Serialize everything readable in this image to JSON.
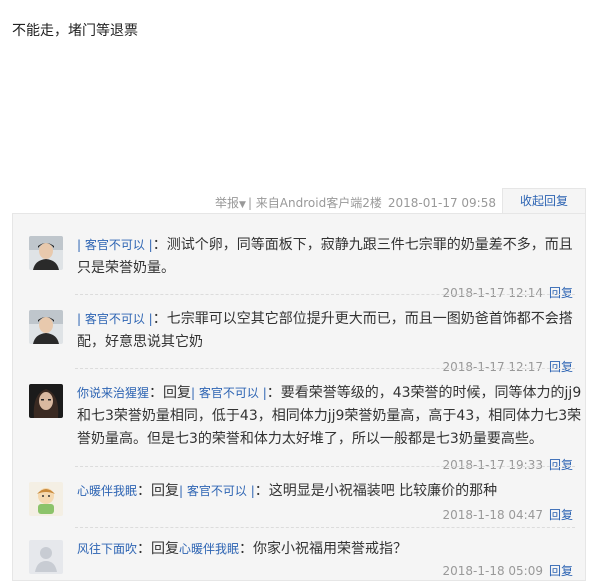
{
  "post": {
    "text": "不能走，堵门等退票"
  },
  "meta": {
    "report": "举报",
    "source": "| 来自Android客户端",
    "floor": "2楼",
    "time": "2018-01-17 09:58",
    "collapse": "收起回复"
  },
  "replies": [
    {
      "avatar": "avatar-boy",
      "user": "",
      "prefix": "",
      "mention": "| 客官不可以 |",
      "text": "：测试个卵，同等面板下，寂静九跟三件七宗罪的奶量差不多，而且只是荣誉奶量。",
      "time": "2018-1-17 12:14",
      "reply_label": "回复"
    },
    {
      "avatar": "avatar-boy",
      "user": "",
      "prefix": "",
      "mention": "| 客官不可以 |",
      "text": "：七宗罪可以空其它部位提升更大而已，而且一图奶爸首饰都不会搭配，好意思说其它奶",
      "time": "2018-1-17 12:17",
      "reply_label": "回复"
    },
    {
      "avatar": "avatar-girl",
      "user": "你说来治猩猩",
      "prefix": "：回复",
      "mention": "| 客官不可以 |",
      "text": "：要看荣誉等级的，43荣誉的时候，同等体力的jj9和七3荣誉奶量相同，低于43，相同体力jj9荣誉奶量高，高于43，相同体力七3荣誉奶量高。但是七3的荣誉和体力太好堆了，所以一般都是七3奶量要高些。",
      "time": "2018-1-17 19:33",
      "reply_label": "回复"
    },
    {
      "avatar": "avatar-cartoon",
      "user": "心暖伴我眠",
      "prefix": "：回复",
      "mention": "| 客官不可以 |",
      "text": "：这明显是小祝福装吧 比较廉价的那种",
      "time": "2018-1-18 04:47",
      "reply_label": "回复"
    },
    {
      "avatar": "avatar-default",
      "user": "风往下面吹",
      "prefix": "：回复",
      "mention": "心暖伴我眠",
      "text": "：你家小祝福用荣誉戒指？",
      "time": "2018-1-18 05:09",
      "reply_label": "回复"
    }
  ]
}
